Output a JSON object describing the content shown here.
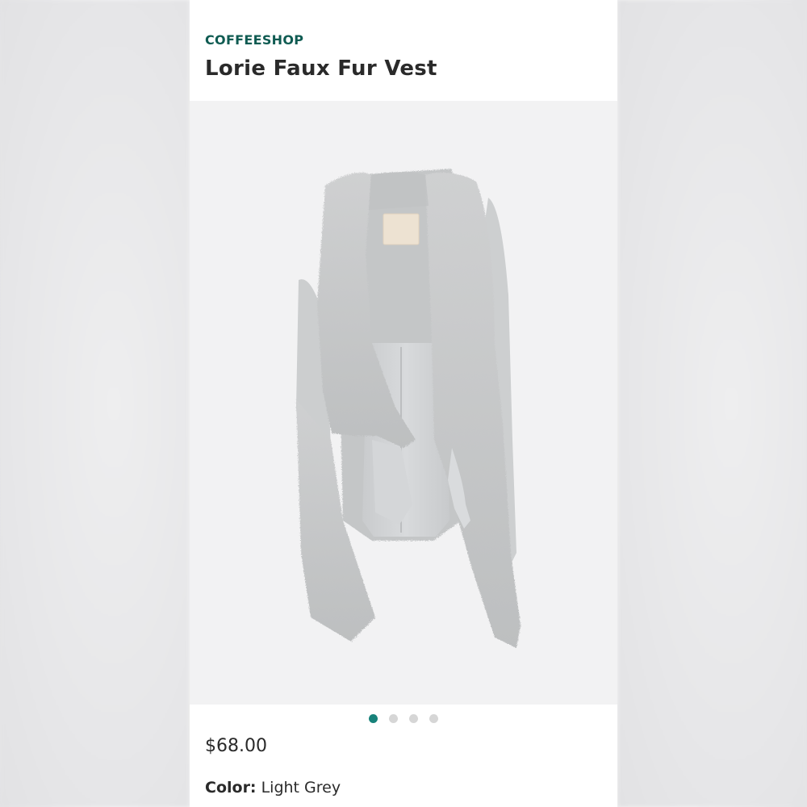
{
  "product": {
    "brand": "COFFEESHOP",
    "title": "Lorie Faux Fur Vest",
    "image_icon": "vest-photo",
    "price": "$68.00",
    "color_label": "Color:",
    "color_value": "Light Grey"
  },
  "carousel": {
    "total": 4,
    "active_index": 0
  },
  "colors": {
    "brand": "#0f5b52",
    "dot_active": "#17827a",
    "dot_inactive": "#d6d6d6",
    "fur": "#c8c9ca",
    "fabric": "#d3d5d7"
  }
}
